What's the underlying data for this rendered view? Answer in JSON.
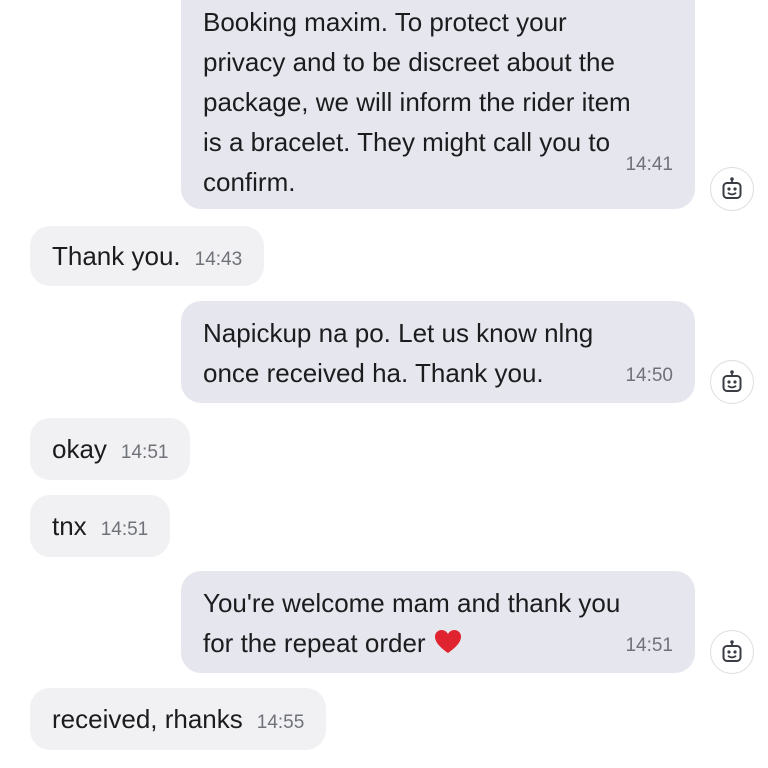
{
  "messages": [
    {
      "direction": "outgoing",
      "text": "Booking maxim. To protect your\nprivacy and to be discreet about the\npackage, we will inform the rider item\nis a bracelet. They might call you to\nconfirm.",
      "time": "14:41",
      "bot_icon": "robot-icon"
    },
    {
      "direction": "incoming",
      "text": "Thank you.",
      "time": "14:43"
    },
    {
      "direction": "outgoing",
      "text": "Napickup na po. Let us know nlng\nonce received ha. Thank you.",
      "time": "14:50",
      "bot_icon": "robot-icon"
    },
    {
      "direction": "incoming",
      "text": "okay",
      "time": "14:51"
    },
    {
      "direction": "incoming",
      "text": "tnx",
      "time": "14:51"
    },
    {
      "direction": "outgoing",
      "text": "You're welcome mam and thank you\nfor the repeat order",
      "emoji": "heart-emoji",
      "time": "14:51",
      "bot_icon": "robot-icon"
    },
    {
      "direction": "incoming",
      "text": "received, rhanks",
      "time": "14:55"
    }
  ],
  "colors": {
    "outgoing_bubble": "#e6e7ee",
    "incoming_bubble": "#f1f1f4",
    "heart": "#e0242f"
  }
}
